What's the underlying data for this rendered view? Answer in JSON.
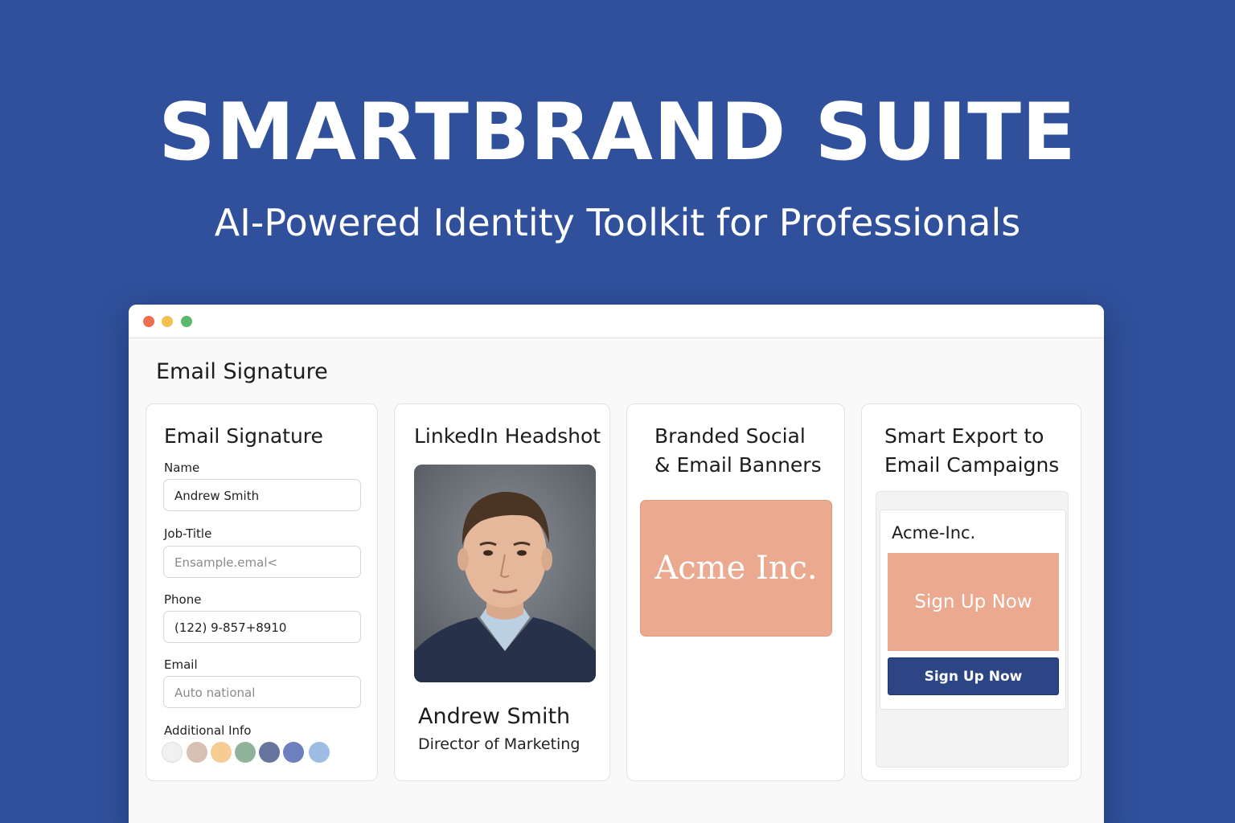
{
  "hero": {
    "title": "SMARTBRAND SUITE",
    "subtitle": "AI-Powered Identity Toolkit for Professionals"
  },
  "window": {
    "heading": "Email Signature",
    "controls": [
      "close",
      "minimize",
      "maximize"
    ]
  },
  "cards": {
    "signature": {
      "title": "Email Signature",
      "fields": [
        {
          "label": "Name",
          "value": "Andrew Smith",
          "placeholder": ""
        },
        {
          "label": "Job-Title",
          "value": "",
          "placeholder": "Ensample.emal<"
        },
        {
          "label": "Phone",
          "value": "(122) 9-857+8910",
          "placeholder": ""
        },
        {
          "label": "Email",
          "value": "",
          "placeholder": "Auto national"
        }
      ],
      "additional_label": "Additional Info",
      "swatches": [
        "#f1f1f1",
        "#d8c0b5",
        "#f5cc91",
        "#8fb39b",
        "#65759d",
        "#6e7fbf",
        "#9ebde2"
      ]
    },
    "headshot": {
      "title": "LinkedIn Headshot",
      "name": "Andrew Smith",
      "role": "Director of Marketing"
    },
    "banners": {
      "title_line1": "Branded Social",
      "title_line2": "& Email Banners",
      "banner_text": "Acme Inc."
    },
    "export": {
      "title_line1": "Smart Export to",
      "title_line2": "Email Campaigns",
      "company": "Acme-Inc.",
      "banner_text": "Sign Up Now",
      "button_label": "Sign Up Now"
    }
  },
  "colors": {
    "background": "#30509c",
    "accent_peach": "#eba98f",
    "button_navy": "#2c4585"
  }
}
